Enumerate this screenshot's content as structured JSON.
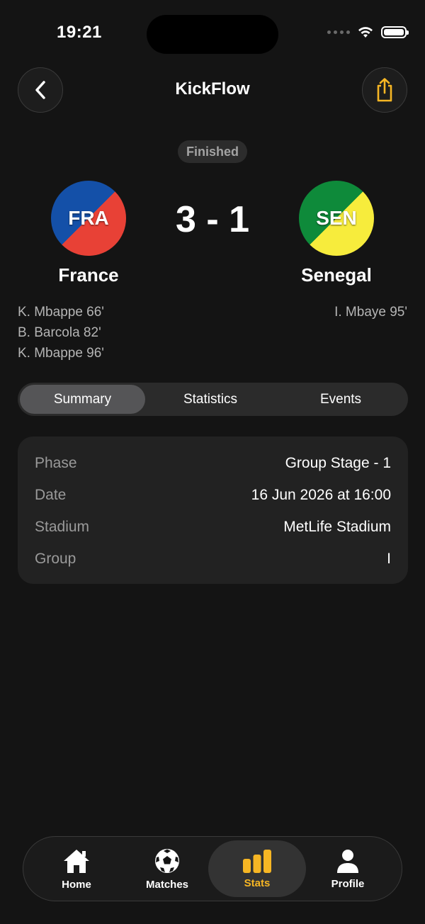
{
  "status_bar": {
    "time": "19:21"
  },
  "header": {
    "title": "KickFlow",
    "back_icon": "chevron-left-icon",
    "share_icon": "share-icon",
    "accent": "#f6b624"
  },
  "match": {
    "status": "Finished",
    "score": "3 - 1",
    "home": {
      "code": "FRA",
      "name": "France",
      "colors": [
        "#1450a8",
        "#e84136"
      ],
      "scorers": [
        "K. Mbappe 66'",
        "B. Barcola 82'",
        "K. Mbappe 96'"
      ]
    },
    "away": {
      "code": "SEN",
      "name": "Senegal",
      "colors": [
        "#0e8a3a",
        "#f7ec3c"
      ],
      "scorers": [
        "I. Mbaye 95'"
      ]
    }
  },
  "tabs": [
    {
      "label": "Summary",
      "active": true
    },
    {
      "label": "Statistics",
      "active": false
    },
    {
      "label": "Events",
      "active": false
    }
  ],
  "summary": [
    {
      "label": "Phase",
      "value": "Group Stage - 1"
    },
    {
      "label": "Date",
      "value": "16 Jun 2026 at 16:00"
    },
    {
      "label": "Stadium",
      "value": "MetLife Stadium"
    },
    {
      "label": "Group",
      "value": "I"
    }
  ],
  "tabbar": [
    {
      "label": "Home",
      "icon": "home-icon",
      "active": false
    },
    {
      "label": "Matches",
      "icon": "soccer-ball-icon",
      "active": false
    },
    {
      "label": "Stats",
      "icon": "bar-chart-icon",
      "active": true
    },
    {
      "label": "Profile",
      "icon": "person-icon",
      "active": false
    }
  ]
}
